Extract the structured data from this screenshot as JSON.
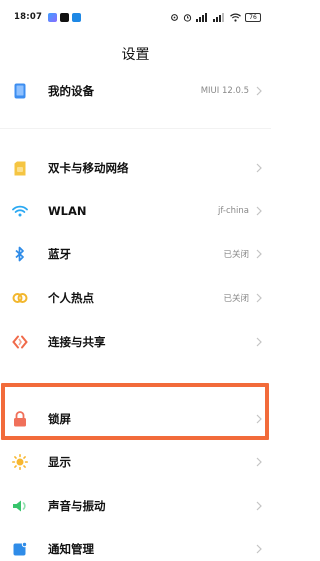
{
  "status_bar": {
    "time": "18:07",
    "battery": "76"
  },
  "page": {
    "title": "设置"
  },
  "items": [
    {
      "label": "我的设备",
      "value": "MIUI 12.0.5",
      "icon": "phone-icon"
    },
    {
      "label": "双卡与移动网络",
      "value": "",
      "icon": "sim-card-icon"
    },
    {
      "label": "WLAN",
      "value": "jf-china",
      "icon": "wifi-icon"
    },
    {
      "label": "蓝牙",
      "value": "已关闭",
      "icon": "bluetooth-icon"
    },
    {
      "label": "个人热点",
      "value": "已关闭",
      "icon": "hotspot-icon"
    },
    {
      "label": "连接与共享",
      "value": "",
      "icon": "share-icon"
    },
    {
      "label": "锁屏",
      "value": "",
      "icon": "lock-icon"
    },
    {
      "label": "显示",
      "value": "",
      "icon": "sun-icon"
    },
    {
      "label": "声音与振动",
      "value": "",
      "icon": "speaker-icon"
    },
    {
      "label": "通知管理",
      "value": "",
      "icon": "notification-icon"
    }
  ],
  "colors": {
    "highlight": "#f26b3a",
    "device": "#3d8ef0",
    "sim": "#f5c542",
    "wifi": "#2aa8f2",
    "bluetooth": "#2f8ce8",
    "hotspot": "#f2b62c",
    "share": "#f06a4a",
    "lock": "#f0705a",
    "display": "#f7b731",
    "sound": "#37c46b",
    "notification": "#2f8ce8"
  }
}
